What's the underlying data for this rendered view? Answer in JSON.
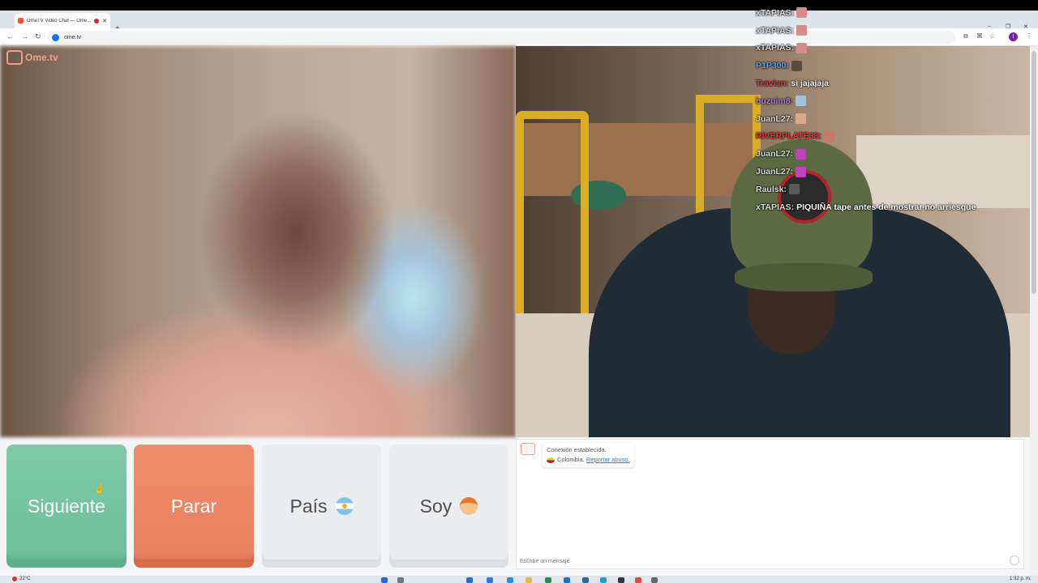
{
  "browser": {
    "tab_title": "OmeTV Video Chat — Ome...",
    "tab_close": "✕",
    "new_tab": "+",
    "tab_menu": "⌄",
    "url": "ome.tv",
    "win_minimize": "–",
    "win_restore": "❐",
    "win_close": "✕",
    "profile_initial": "I"
  },
  "app": {
    "logo_text": "Ome.tv"
  },
  "stream_chat": [
    {
      "user": "xTAPIAS:",
      "color": "#d9d9d9",
      "msg": "",
      "emote": "#d98a8a"
    },
    {
      "user": "xTAPIAS:",
      "color": "#d9d9d9",
      "msg": "",
      "emote": "#d98a8a"
    },
    {
      "user": "xTAPIAS:",
      "color": "#d9d9d9",
      "msg": "",
      "emote": "#d98a8a"
    },
    {
      "user": "P1P300:",
      "color": "#5aa0e6",
      "msg": "",
      "emote": "#5a4a42"
    },
    {
      "user": "Travian:",
      "color": "#e03a3a",
      "msg": "si jajajaja",
      "emote": ""
    },
    {
      "user": "buzuim8:",
      "color": "#b77ae6",
      "msg": "",
      "emote": "#9fc3d8"
    },
    {
      "user": "JuanL27:",
      "color": "#d9d9d9",
      "msg": "",
      "emote": "#d9a98a"
    },
    {
      "user": "RIVERPLATE33:",
      "color": "#e03a3a",
      "msg": "",
      "emote": "#c47a6a"
    },
    {
      "user": "JuanL27:",
      "color": "#d9d9d9",
      "msg": "",
      "emote": "#c040c0"
    },
    {
      "user": "JuanL27:",
      "color": "#d9d9d9",
      "msg": "",
      "emote": "#c040c0"
    },
    {
      "user": "Raulsk:",
      "color": "#d9d9d9",
      "msg": "",
      "emote": "#5a5a5a"
    },
    {
      "user": "xTAPIAS:",
      "color": "#d9d9d9",
      "msg": "PIQUIÑA tape antes de mostrar no arriesgue",
      "emote": ""
    }
  ],
  "controls": {
    "next_label": "Siguiente",
    "stop_label": "Parar",
    "country_label": "País",
    "gender_label": "Soy"
  },
  "chat": {
    "system_line1": "Conexión establecida.",
    "country": "Colombia.",
    "report_link": "Reportar abuso.",
    "input_placeholder": "Escribe un mensaje"
  },
  "taskbar": {
    "weather": "22°C",
    "clock": "1:32 p. m."
  }
}
